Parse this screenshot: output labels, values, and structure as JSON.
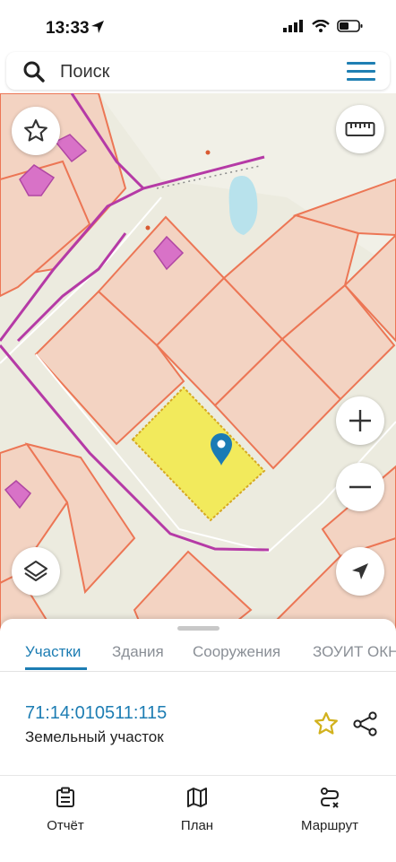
{
  "status_bar": {
    "time": "13:33"
  },
  "search": {
    "placeholder": "Поиск"
  },
  "tabs": [
    {
      "label": "Участки",
      "active": true
    },
    {
      "label": "Здания",
      "active": false
    },
    {
      "label": "Сооружения",
      "active": false
    },
    {
      "label": "ЗОУИТ ОКН",
      "active": false
    }
  ],
  "parcel": {
    "cadastral_number": "71:14:010511:115",
    "type": "Земельный участок",
    "favorite": false
  },
  "bottom_nav": [
    {
      "label": "Отчёт",
      "icon": "report-icon"
    },
    {
      "label": "План",
      "icon": "map-plan-icon"
    },
    {
      "label": "Маршрут",
      "icon": "route-icon"
    }
  ],
  "colors": {
    "accent": "#1d7db3",
    "parcel_highlight": "#f2ea5c",
    "parcel_border": "#e8704e",
    "boundary_line": "#b53aa6",
    "building_fill": "#d872c7",
    "favorite_star": "#d2b21e"
  }
}
